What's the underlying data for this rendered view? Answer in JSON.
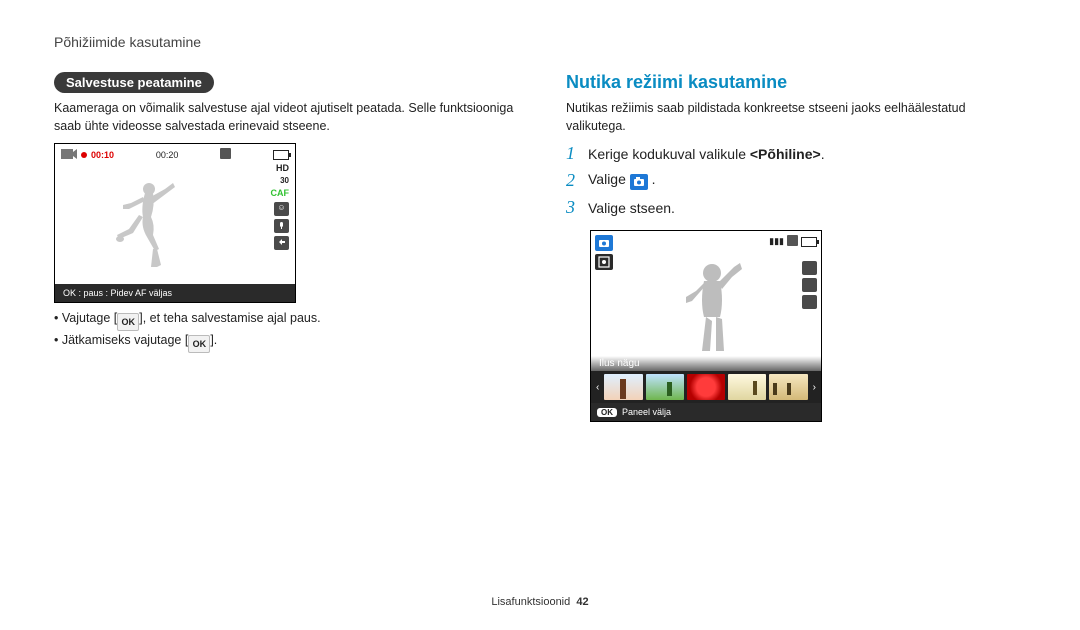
{
  "running_head": "Põhižiimide kasutamine",
  "left": {
    "pill": "Salvestuse peatamine",
    "intro": "Kaameraga on võimalik salvestuse ajal videot ajutiselt peatada. Selle funktsiooniga saab ühte videosse salvestada erinevaid stseene.",
    "rec": {
      "elapsed": "00:10",
      "remaining": "00:20",
      "hd": "HD",
      "fps": "30",
      "caf": "CAF",
      "footer": "OK : paus     : Pidev AF väljas"
    },
    "bullets": [
      {
        "pre": "Vajutage [",
        "ok": "OK",
        "post": "], et teha salvestamise ajal paus."
      },
      {
        "pre": "Jätkamiseks vajutage [",
        "ok": "OK",
        "post": "]."
      }
    ]
  },
  "right": {
    "title": "Nutika režiimi kasutamine",
    "intro": "Nutikas režiimis saab pildistada konkreetse stseeni jaoks eelhäälestatud valikutega.",
    "steps": [
      {
        "n": "1",
        "text_pre": "Kerige kodukuval valikule ",
        "bold": "<Põhiline>",
        "text_post": "."
      },
      {
        "n": "2",
        "text_pre": "Valige ",
        "icon": true,
        "text_post": " ."
      },
      {
        "n": "3",
        "text_pre": "Valige stseen.",
        "text_post": ""
      }
    ],
    "smart": {
      "overlay_label": "Ilus nägu",
      "footer_ok": "OK",
      "footer_text": "Paneel välja"
    }
  },
  "footer": {
    "section": "Lisafunktsioonid",
    "page": "42"
  }
}
